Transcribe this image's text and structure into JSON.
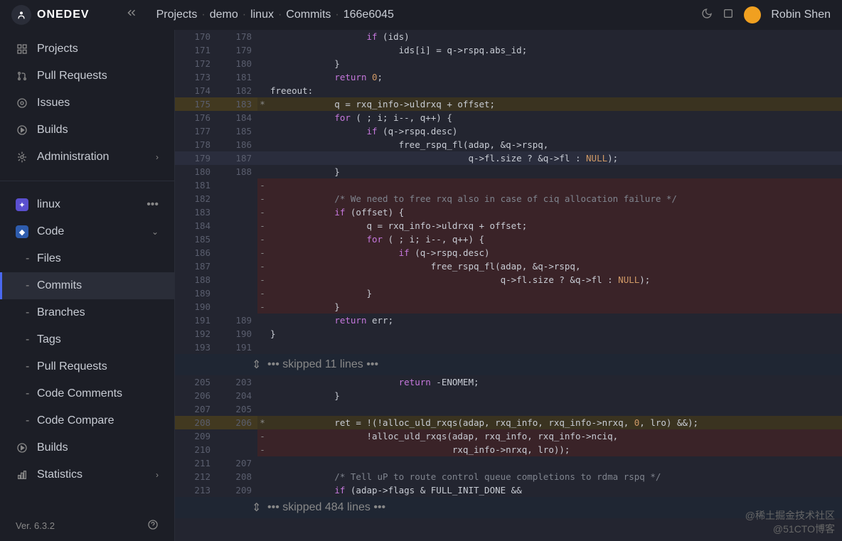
{
  "brand": "ONEDEV",
  "breadcrumb": {
    "projects": "Projects",
    "demo": "demo",
    "linux": "linux",
    "commits": "Commits",
    "hash": "166e6045"
  },
  "user": {
    "name": "Robin Shen"
  },
  "sidebar": {
    "primary": [
      {
        "label": "Projects"
      },
      {
        "label": "Pull Requests"
      },
      {
        "label": "Issues"
      },
      {
        "label": "Builds"
      },
      {
        "label": "Administration"
      }
    ],
    "project": {
      "label": "linux"
    },
    "code": {
      "label": "Code"
    },
    "code_items": [
      {
        "label": "Files"
      },
      {
        "label": "Commits"
      },
      {
        "label": "Branches"
      },
      {
        "label": "Tags"
      },
      {
        "label": "Pull Requests"
      },
      {
        "label": "Code Comments"
      },
      {
        "label": "Code Compare"
      }
    ],
    "bottom": [
      {
        "label": "Builds"
      },
      {
        "label": "Statistics"
      }
    ]
  },
  "version": "Ver. 6.3.2",
  "diff": {
    "skip1": "••• skipped 11 lines •••",
    "skip2": "••• skipped 484 lines •••",
    "rows": [
      {
        "old": "170",
        "new": "178",
        "m": "",
        "code": "                  if (ids)",
        "type": "ctx",
        "kw": "if"
      },
      {
        "old": "171",
        "new": "179",
        "m": "",
        "code": "                        ids[i] = q->rspq.abs_id;",
        "type": "ctx"
      },
      {
        "old": "172",
        "new": "180",
        "m": "",
        "code": "            }",
        "type": "ctx"
      },
      {
        "old": "173",
        "new": "181",
        "m": "",
        "code": "            return 0;",
        "type": "ctx",
        "kw": "return"
      },
      {
        "old": "174",
        "new": "182",
        "m": "",
        "code": "freeout:",
        "type": "ctx"
      },
      {
        "old": "175",
        "new": "183",
        "m": "*",
        "code": "            q = rxq_info->uldrxq + offset;",
        "type": "mod",
        "hl": "+ offset"
      },
      {
        "old": "176",
        "new": "184",
        "m": "",
        "code": "            for ( ; i; i--, q++) {",
        "type": "ctx",
        "kw": "for"
      },
      {
        "old": "177",
        "new": "185",
        "m": "",
        "code": "                  if (q->rspq.desc)",
        "type": "ctx",
        "kw": "if"
      },
      {
        "old": "178",
        "new": "186",
        "m": "",
        "code": "                        free_rspq_fl(adap, &q->rspq,",
        "type": "ctx"
      },
      {
        "old": "179",
        "new": "187",
        "m": "",
        "code": "                                     q->fl.size ? &q->fl : NULL);",
        "type": "cursor"
      },
      {
        "old": "180",
        "new": "188",
        "m": "",
        "code": "            }",
        "type": "ctx"
      },
      {
        "old": "181",
        "new": "",
        "m": "-",
        "code": "",
        "type": "del"
      },
      {
        "old": "182",
        "new": "",
        "m": "-",
        "code": "            /* We need to free rxq also in case of ciq allocation failure */",
        "type": "del",
        "cmt": true
      },
      {
        "old": "183",
        "new": "",
        "m": "-",
        "code": "            if (offset) {",
        "type": "del",
        "kw": "if"
      },
      {
        "old": "184",
        "new": "",
        "m": "-",
        "code": "                  q = rxq_info->uldrxq + offset;",
        "type": "del"
      },
      {
        "old": "185",
        "new": "",
        "m": "-",
        "code": "                  for ( ; i; i--, q++) {",
        "type": "del",
        "kw": "for"
      },
      {
        "old": "186",
        "new": "",
        "m": "-",
        "code": "                        if (q->rspq.desc)",
        "type": "del",
        "kw": "if"
      },
      {
        "old": "187",
        "new": "",
        "m": "-",
        "code": "                              free_rspq_fl(adap, &q->rspq,",
        "type": "del"
      },
      {
        "old": "188",
        "new": "",
        "m": "-",
        "code": "                                           q->fl.size ? &q->fl : NULL);",
        "type": "del"
      },
      {
        "old": "189",
        "new": "",
        "m": "-",
        "code": "                  }",
        "type": "del"
      },
      {
        "old": "190",
        "new": "",
        "m": "-",
        "code": "            }",
        "type": "del"
      },
      {
        "old": "191",
        "new": "189",
        "m": "",
        "code": "            return err;",
        "type": "ctx",
        "kw": "return"
      },
      {
        "old": "192",
        "new": "190",
        "m": "",
        "code": "}",
        "type": "ctx"
      },
      {
        "old": "193",
        "new": "191",
        "m": "",
        "code": "",
        "type": "ctx"
      }
    ],
    "rows2": [
      {
        "old": "205",
        "new": "203",
        "m": "",
        "code": "                        return -ENOMEM;",
        "type": "ctx",
        "kw": "return"
      },
      {
        "old": "206",
        "new": "204",
        "m": "",
        "code": "            }",
        "type": "ctx"
      },
      {
        "old": "207",
        "new": "205",
        "m": "",
        "code": "",
        "type": "ctx"
      },
      {
        "old": "208",
        "new": "206",
        "m": "*",
        "code": "            ret = !(!alloc_uld_rxqs(adap, rxq_info, rxq_info->nrxq, 0, lro) &&);",
        "type": "mod"
      },
      {
        "old": "209",
        "new": "",
        "m": "-",
        "code": "                  !alloc_uld_rxqs(adap, rxq_info, rxq_info->nciq,",
        "type": "del"
      },
      {
        "old": "210",
        "new": "",
        "m": "-",
        "code": "                                  rxq_info->nrxq, lro));",
        "type": "del"
      },
      {
        "old": "211",
        "new": "207",
        "m": "",
        "code": "",
        "type": "ctx"
      },
      {
        "old": "212",
        "new": "208",
        "m": "",
        "code": "            /* Tell uP to route control queue completions to rdma rspq */",
        "type": "ctx",
        "cmt": true
      },
      {
        "old": "213",
        "new": "209",
        "m": "",
        "code": "            if (adap->flags & FULL_INIT_DONE &&",
        "type": "ctx",
        "kw": "if"
      }
    ]
  },
  "watermark": {
    "line1": "@稀土掘金技术社区",
    "line2": "@51CTO博客"
  }
}
